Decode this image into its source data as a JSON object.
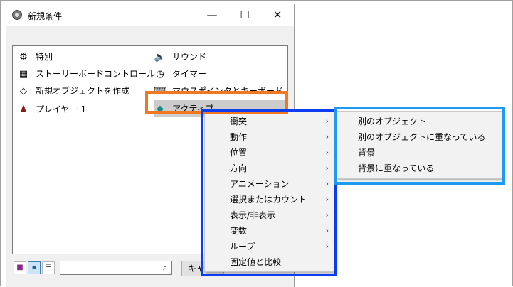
{
  "window": {
    "title": "新規条件",
    "minimize_glyph": "—",
    "maximize_glyph": "☐",
    "close_glyph": "✕"
  },
  "list": {
    "items": [
      {
        "label": "特別",
        "icon": "gears-icon"
      },
      {
        "label": "サウンド",
        "icon": "speaker-icon"
      },
      {
        "label": "ストーリーボードコントロール",
        "icon": "checkered-flag-icon"
      },
      {
        "label": "タイマー",
        "icon": "stopwatch-icon"
      },
      {
        "label": "新規オブジェクトを作成",
        "icon": "new-object-icon"
      },
      {
        "label": "マウスポインタとキーボード",
        "icon": "keyboard-icon"
      },
      {
        "label": "プレイヤー 1",
        "icon": "joystick-icon"
      },
      {
        "label": "アクティブ",
        "icon": "active-object-icon",
        "selected": true
      }
    ]
  },
  "bottom": {
    "search_value": "",
    "cancel_label": "キャ"
  },
  "context_menu": {
    "items": [
      "衝突",
      "動作",
      "位置",
      "方向",
      "アニメーション",
      "選択またはカウント",
      "表示/非表示",
      "変数",
      "ループ",
      "固定値と比較"
    ],
    "submenu_arrow": "›"
  },
  "submenu": {
    "items": [
      "別のオブジェクト",
      "別のオブジェクトに重なっている",
      "背景",
      "背景に重なっている"
    ]
  },
  "colors": {
    "highlight_orange": "#f07820",
    "highlight_blue": "#0a3cf0",
    "highlight_lightblue": "#1e9bf0"
  }
}
